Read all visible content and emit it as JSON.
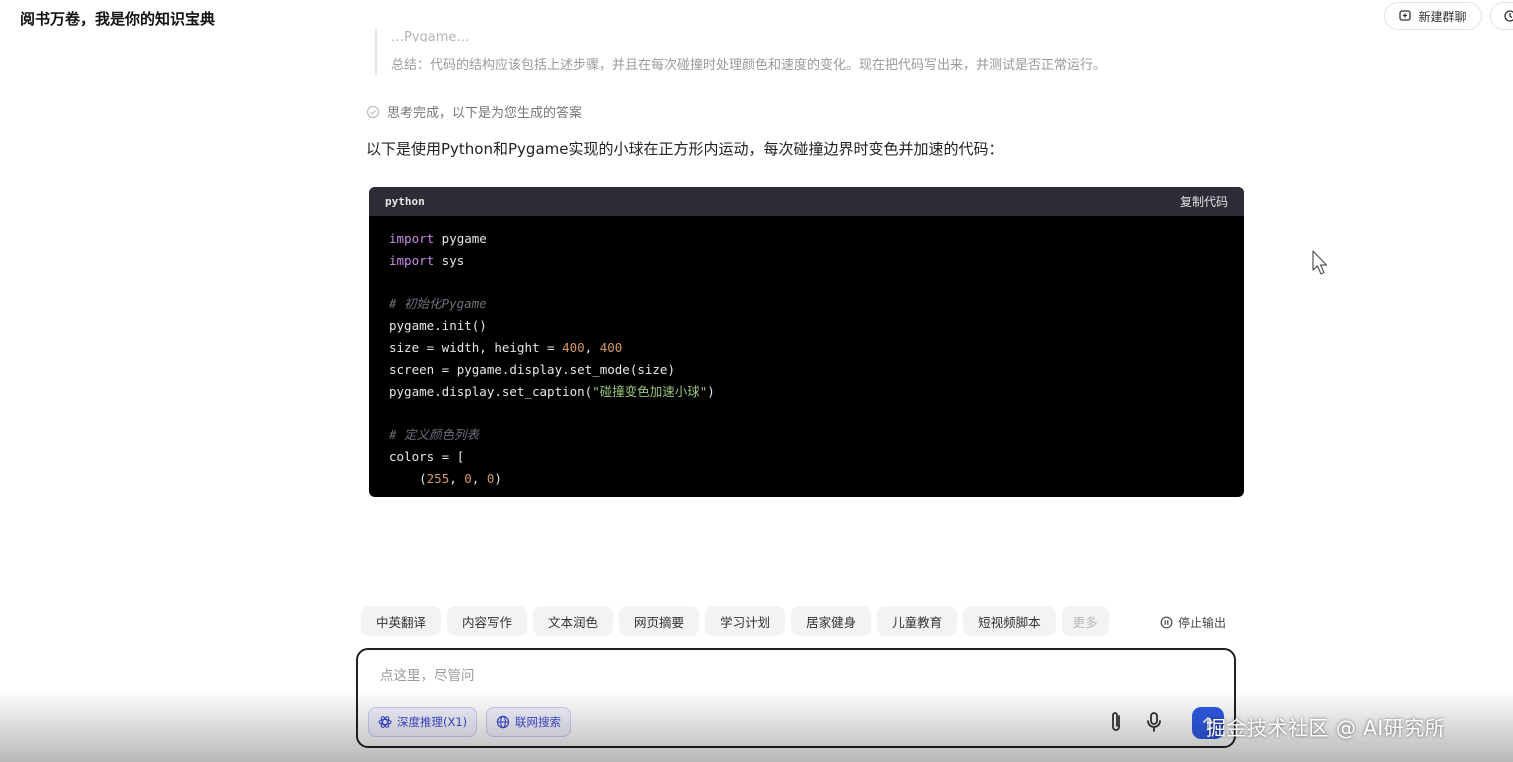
{
  "header": {
    "app_title": "阅书万卷，我是你的知识宝典",
    "new_chat_label": "新建群聊"
  },
  "thinking": {
    "cut_line": "…Pygame…",
    "summary": "总结：代码的结构应该包括上述步骤，并且在每次碰撞时处理颜色和速度的变化。现在把代码写出来，并测试是否正常运行。",
    "done_label": "思考完成，以下是为您生成的答案"
  },
  "answer": {
    "intro": "以下是使用Python和Pygame实现的小球在正方形内运动，每次碰撞边界时变色并加速的代码："
  },
  "code": {
    "language": "python",
    "copy_label": "复制代码",
    "lines": [
      {
        "kw": "import",
        "rest": " pygame"
      },
      {
        "kw": "import",
        "rest": " sys"
      },
      {
        "blank": true
      },
      {
        "comment": "# 初始化Pygame"
      },
      {
        "text": "pygame.init()"
      },
      {
        "pre": "size = width, height = ",
        "n1": "400",
        "mid": ", ",
        "n2": "400"
      },
      {
        "text": "screen = pygame.display.set_mode(size)"
      },
      {
        "pre": "pygame.display.set_caption(",
        "str": "\"碰撞变色加速小球\"",
        "post": ")"
      },
      {
        "blank": true
      },
      {
        "comment": "# 定义颜色列表"
      },
      {
        "text": "colors = ["
      },
      {
        "pre": "    (",
        "n1": "255",
        "mid": ", ",
        "n2": "0",
        "mid2": ", ",
        "n3": "0",
        "post": ")"
      }
    ]
  },
  "chips": [
    "中英翻译",
    "内容写作",
    "文本润色",
    "网页摘要",
    "学习计划",
    "居家健身",
    "儿童教育",
    "短视频脚本",
    "更多"
  ],
  "stop_output_label": "停止输出",
  "input": {
    "placeholder": "点这里，尽管问",
    "deep_reasoning_label": "深度推理(X1)",
    "web_search_label": "联网搜索"
  },
  "watermark": "掘金技术社区 @ AI研究所",
  "colors": {
    "accent": "#2f5be6",
    "code_bg": "#000000",
    "code_header_bg": "#2d2d38"
  }
}
